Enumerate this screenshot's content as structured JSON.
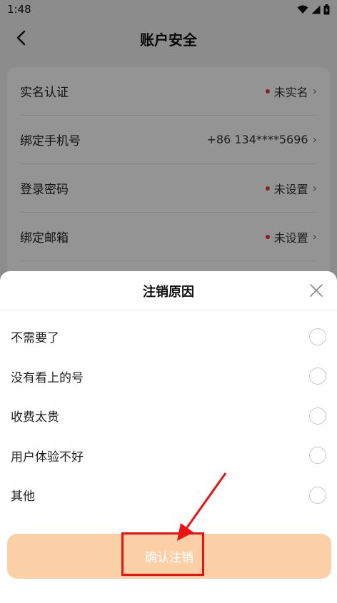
{
  "status_bar": {
    "time": "1:48",
    "icons": [
      "wifi-icon",
      "signal-icon",
      "battery-icon"
    ]
  },
  "header": {
    "title": "账户安全"
  },
  "settings": [
    {
      "label": "实名认证",
      "value": "未实名",
      "dot": true
    },
    {
      "label": "绑定手机号",
      "value": "+86 134****5696",
      "dot": false
    },
    {
      "label": "登录密码",
      "value": "未设置",
      "dot": true
    },
    {
      "label": "绑定邮箱",
      "value": "未设置",
      "dot": true
    }
  ],
  "sheet": {
    "title": "注销原因",
    "reasons": [
      {
        "label": "不需要了"
      },
      {
        "label": "没有看上的号"
      },
      {
        "label": "收费太贵"
      },
      {
        "label": "用户体验不好"
      },
      {
        "label": "其他"
      }
    ],
    "confirm_label": "确认注销"
  },
  "colors": {
    "confirm_button": "#fbd0a6",
    "status_dot": "#e23b3b",
    "annotation": "#ee1111"
  }
}
